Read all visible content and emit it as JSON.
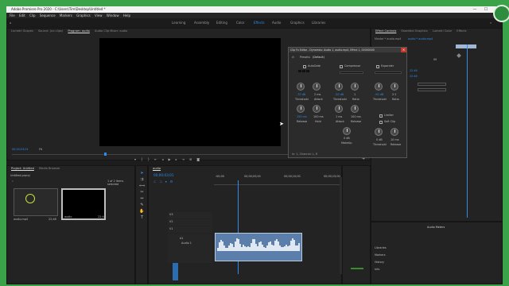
{
  "titlebar": {
    "title": "Adobe Premiere Pro 2020 - C:\\Users\\Tim\\Desktop\\Untitled *",
    "min": "—",
    "max": "☐",
    "close": "✕"
  },
  "menu": [
    "File",
    "Edit",
    "Clip",
    "Sequence",
    "Markers",
    "Graphics",
    "View",
    "Window",
    "Help"
  ],
  "workspaces": [
    "Learning",
    "Assembly",
    "Editing",
    "Color",
    "Effects",
    "Audio",
    "Graphics",
    "Libraries"
  ],
  "active_workspace": "Effects",
  "source_tabs": [
    "Lumetri Scopes",
    "Source: (no clips)",
    "Program: audio",
    "Audio Clip Mixer: audio"
  ],
  "program": {
    "timecode": "00;00;03;01",
    "fit": "Fit"
  },
  "right_tabs": [
    "Effect Controls",
    "Essential Graphics",
    "Lumetri Color",
    "Effects"
  ],
  "effect_controls": {
    "master": "Master * audio.mp4",
    "clip": "audio * audio.mp4",
    "time": "",
    "values": [
      "00",
      "22.46",
      "22.46"
    ]
  },
  "clipfx": {
    "title": "Clip Fx Editor - Dynamics: Audio 1, audio.mp4, Effect 1, 00000000",
    "presets_label": "Presets:",
    "preset_value": "(Default)",
    "autogate": "AutoGate",
    "compressor": "Compressor",
    "expander": "Expander",
    "gate_vals": [
      "-70 dB",
      "2 ms"
    ],
    "gate_labels": [
      "Threshold",
      "Attack"
    ],
    "gate_vals2": [
      "150 ms",
      "100 ms"
    ],
    "gate_labels2": [
      "Release",
      "Hold"
    ],
    "comp_vals": [
      "-20 dB",
      "1"
    ],
    "comp_labels": [
      "Threshold",
      "Ratio"
    ],
    "comp_vals2": [
      "1 ms",
      "100 ms"
    ],
    "comp_labels2": [
      "Attack",
      "Release"
    ],
    "comp_vals3": [
      "0 dB"
    ],
    "comp_labels3": [
      "MakeUp"
    ],
    "exp_vals": [
      "-50 dB",
      "2:1"
    ],
    "exp_labels": [
      "Threshold",
      "Ratio"
    ],
    "limiter": "Limiter",
    "soft": "Soft Clip",
    "lim_vals": [
      "0 dB",
      "10 ms"
    ],
    "lim_labels": [
      "Threshold",
      "Release"
    ],
    "footer": "In: 1, Channel: L, R"
  },
  "project": {
    "tabs": [
      "Project: Untitled",
      "Media Browser"
    ],
    "file": "Untitled.prproj",
    "count": "1 of 2 items selected",
    "items": [
      {
        "name": "audio.mp4",
        "dur": "22;46"
      },
      {
        "name": "audio",
        "dur": "22;46"
      }
    ]
  },
  "timeline": {
    "tab": "audio",
    "timecode": "00;00;03;01",
    "ruler": [
      ":00;00",
      "00;00;05;00",
      "00;00;10;00",
      "00;00;15;00"
    ],
    "tracks": [
      "V3",
      "V2",
      "V1",
      "A1",
      "A2",
      "A3"
    ],
    "audio_track": "Audio 1"
  },
  "right_lower": {
    "header": "Audio Meters",
    "items": [
      "Libraries",
      "Markers",
      "History",
      "Info"
    ]
  }
}
